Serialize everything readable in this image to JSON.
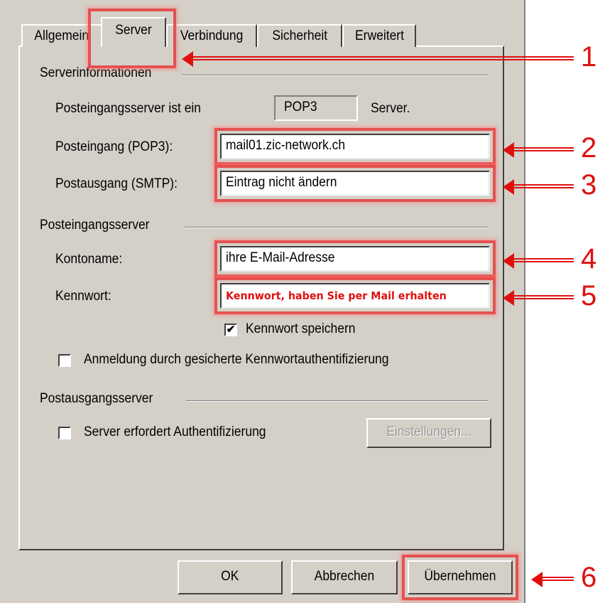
{
  "tabs": [
    {
      "label": "Allgemein"
    },
    {
      "label": "Server"
    },
    {
      "label": "Verbindung"
    },
    {
      "label": "Sicherheit"
    },
    {
      "label": "Erweitert"
    }
  ],
  "server_info": {
    "group_title": "Serverinformationen",
    "incoming_type_label": "Posteingangsserver ist ein",
    "incoming_type_value": "POP3",
    "incoming_type_suffix": "Server.",
    "incoming_label": "Posteingang (POP3):",
    "incoming_value": "mail01.zic-network.ch",
    "outgoing_label": "Postausgang (SMTP):",
    "outgoing_value": "Eintrag nicht ändern"
  },
  "incoming_server": {
    "group_title": "Posteingangsserver",
    "account_label": "Kontoname:",
    "account_value": "ihre E-Mail-Adresse",
    "password_label": "Kennwort:",
    "password_value": "Kennwort, haben Sie per Mail erhalten",
    "save_password_label": "Kennwort speichern",
    "save_password_checked": true,
    "spa_label": "Anmeldung durch gesicherte Kennwortauthentifizierung",
    "spa_checked": false
  },
  "outgoing_server": {
    "group_title": "Postausgangsserver",
    "auth_label": "Server erfordert Authentifizierung",
    "auth_checked": false,
    "settings_button": "Einstellungen..."
  },
  "buttons": {
    "ok": "OK",
    "cancel": "Abbrechen",
    "apply": "Übernehmen"
  },
  "annotations": [
    "1",
    "2",
    "3",
    "4",
    "5",
    "6"
  ],
  "colors": {
    "dialog_bg": "#d4d0c8",
    "annotation": "#e01010",
    "password_text": "#e01010"
  }
}
